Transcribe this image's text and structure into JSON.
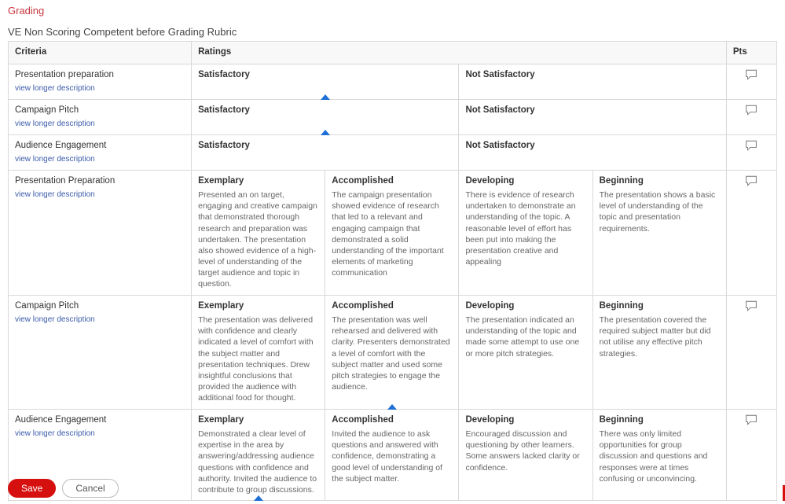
{
  "page": {
    "heading": "Grading",
    "rubric_title": "VE Non Scoring Competent before Grading Rubric"
  },
  "headers": {
    "criteria": "Criteria",
    "ratings": "Ratings",
    "pts": "Pts"
  },
  "view_label": "view longer description",
  "rows": [
    {
      "criteria": "Presentation preparation",
      "type": "two",
      "ratings": [
        {
          "title": "Satisfactory"
        },
        {
          "title": "Not Satisfactory"
        }
      ],
      "selected_upto": 1,
      "arrow_at": 0
    },
    {
      "criteria": "Campaign Pitch",
      "type": "two",
      "ratings": [
        {
          "title": "Satisfactory"
        },
        {
          "title": "Not Satisfactory"
        }
      ],
      "selected_upto": 1,
      "arrow_at": 0
    },
    {
      "criteria": "Audience Engagement",
      "type": "two",
      "ratings": [
        {
          "title": "Satisfactory"
        },
        {
          "title": "Not Satisfactory"
        }
      ],
      "selected_upto": 1,
      "arrow_at": null
    },
    {
      "criteria": "Presentation Preparation",
      "type": "four",
      "ratings": [
        {
          "title": "Exemplary",
          "desc": "Presented an on target, engaging and creative campaign that demonstrated thorough research and preparation was undertaken. The presentation also showed evidence of a high-level of understanding of the target audience and topic in question."
        },
        {
          "title": "Accomplished",
          "desc": "The campaign presentation showed evidence of research that led to a relevant and engaging campaign that demonstrated a solid understanding of the important elements of marketing communication"
        },
        {
          "title": "Developing",
          "desc": "There is evidence of research undertaken to demonstrate an understanding of the topic. A reasonable level of effort has been put into making the presentation creative and appealing"
        },
        {
          "title": "Beginning",
          "desc": "The presentation shows a basic level of understanding of the topic and presentation requirements."
        }
      ],
      "selected_upto": 0,
      "arrow_at": null
    },
    {
      "criteria": "Campaign Pitch",
      "type": "four",
      "ratings": [
        {
          "title": "Exemplary",
          "desc": "The presentation was delivered with confidence and clearly indicated a level of comfort with the subject matter and presentation techniques. Drew insightful conclusions that provided the audience with additional food for thought."
        },
        {
          "title": "Accomplished",
          "desc": "The presentation was well rehearsed and delivered with clarity. Presenters demonstrated a level of comfort with the subject matter and used some pitch strategies to engage the audience."
        },
        {
          "title": "Developing",
          "desc": "The presentation indicated an understanding of the topic and made some attempt to use one or more pitch strategies."
        },
        {
          "title": "Beginning",
          "desc": "The presentation covered the required subject matter but did not utilise any effective pitch strategies."
        }
      ],
      "selected_upto": 2,
      "arrow_at": 1
    },
    {
      "criteria": "Audience Engagement",
      "type": "four",
      "ratings": [
        {
          "title": "Exemplary",
          "desc": "Demonstrated a clear level of expertise in the area by answering/addressing audience questions with confidence and authority. Invited the audience to contribute to group discussions."
        },
        {
          "title": "Accomplished",
          "desc": "Invited the audience to ask questions and answered with confidence, demonstrating a good level of understanding of the subject matter."
        },
        {
          "title": "Developing",
          "desc": "Encouraged discussion and questioning by other learners. Some answers lacked clarity or confidence."
        },
        {
          "title": "Beginning",
          "desc": "There was only limited opportunities for group discussion and questions and responses were at times confusing or unconvincing."
        }
      ],
      "selected_upto": 1,
      "arrow_at": 0
    }
  ],
  "buttons": {
    "save": "Save",
    "cancel": "Cancel"
  }
}
